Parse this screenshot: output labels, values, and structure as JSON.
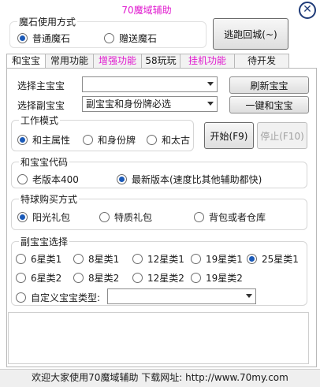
{
  "window": {
    "title": "70魔域辅助"
  },
  "magic_stone": {
    "legend": "魔石使用方式",
    "options": [
      {
        "label": "普通魔石",
        "selected": true
      },
      {
        "label": "赠送魔石",
        "selected": false
      }
    ]
  },
  "escape_button": "逃跑回城(~)",
  "tabs": [
    {
      "label": "和宝宝",
      "active": true,
      "highlight": false
    },
    {
      "label": "常用功能",
      "active": false,
      "highlight": false
    },
    {
      "label": "增强功能",
      "active": false,
      "highlight": true
    },
    {
      "label": "58玩玩",
      "active": false,
      "highlight": false
    },
    {
      "label": "挂机功能",
      "active": false,
      "highlight": true
    },
    {
      "label": "待开发",
      "active": false,
      "highlight": false
    }
  ],
  "main_pet": {
    "label": "选择主宝宝",
    "value": ""
  },
  "sub_pet": {
    "label": "选择副宝宝",
    "value": "副宝宝和身份牌必选"
  },
  "refresh_button": "刷新宝宝",
  "merge_button": "一键和宝宝",
  "work_mode": {
    "legend": "工作模式",
    "options": [
      {
        "label": "和主属性",
        "selected": true
      },
      {
        "label": "和身份牌",
        "selected": false
      },
      {
        "label": "和太古",
        "selected": false
      }
    ]
  },
  "start_button": "开始(F9)",
  "stop_button": "停止(F10)",
  "code": {
    "legend": "和宝宝代码",
    "options": [
      {
        "label": "老版本400",
        "selected": false
      },
      {
        "label": "最新版本(速度比其他辅助都快)",
        "selected": true
      }
    ]
  },
  "ball": {
    "legend": "特球购买方式",
    "options": [
      {
        "label": "阳光礼包",
        "selected": true
      },
      {
        "label": "特质礼包",
        "selected": false
      },
      {
        "label": "背包或者仓库",
        "selected": false
      }
    ]
  },
  "sub_select": {
    "legend": "副宝宝选择",
    "row1": [
      {
        "label": "6星类1",
        "selected": false
      },
      {
        "label": "8星类1",
        "selected": false
      },
      {
        "label": "12星类1",
        "selected": false
      },
      {
        "label": "19星类1",
        "selected": false
      },
      {
        "label": "25星类1",
        "selected": true
      }
    ],
    "row2": [
      {
        "label": "6星类2",
        "selected": false
      },
      {
        "label": "8星类2",
        "selected": false
      },
      {
        "label": "12星类2",
        "selected": false
      },
      {
        "label": "19星类2",
        "selected": false
      }
    ],
    "custom_label": "自定义宝宝类型:",
    "custom_value": ""
  },
  "status_text": "欢迎大家使用70魔域辅助 下载网址: http://www.70my.com"
}
